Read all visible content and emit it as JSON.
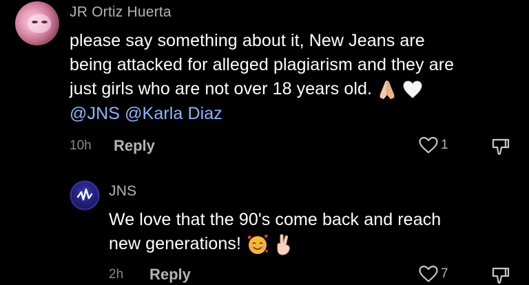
{
  "comment": {
    "username": "JR Ortiz Huerta",
    "text_line1": "please say something about it, New Jeans are",
    "text_line2": "being attacked for alleged plagiarism and they are",
    "text_line3": "just girls who are not over 18 years old.",
    "emojis_line3": [
      "folded-hands-emoji",
      "white-heart-emoji"
    ],
    "mentions": [
      "@JNS",
      "@Karla Diaz"
    ],
    "time": "10h",
    "reply_label": "Reply",
    "like_count": "1"
  },
  "reply": {
    "username": "JNS",
    "text_line1": "We love that the 90's come back and reach",
    "text_line2": "new generations!",
    "emojis_line2": [
      "smiling-face-with-hearts-emoji",
      "crossed-fingers-emoji"
    ],
    "time": "2h",
    "reply_label": "Reply",
    "like_count": "7"
  },
  "colors": {
    "background": "#000000",
    "primary_text": "#ffffff",
    "secondary_text": "#b4b4b4",
    "mention": "#8cb6ff"
  },
  "icons": [
    "heart-outline-icon",
    "dislike-icon"
  ]
}
